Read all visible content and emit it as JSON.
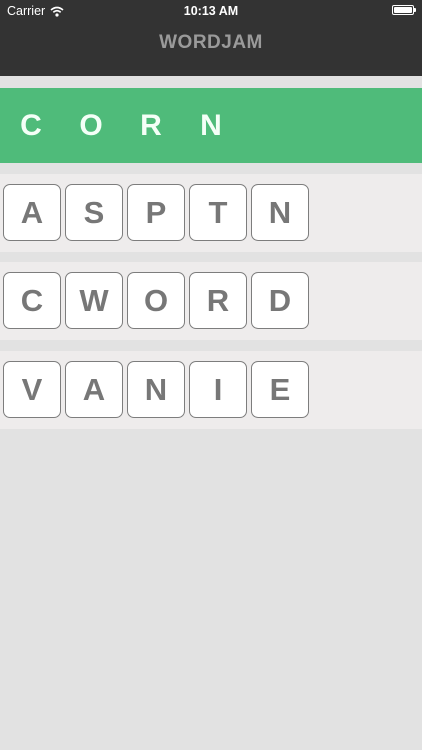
{
  "status_bar": {
    "carrier": "Carrier",
    "time": "10:13 AM"
  },
  "header": {
    "title": "WORDJAM"
  },
  "answer": {
    "letters": [
      "C",
      "O",
      "R",
      "N"
    ],
    "background_color": "#4fbb7a"
  },
  "rows": [
    {
      "letters": [
        "A",
        "S",
        "P",
        "T",
        "N"
      ]
    },
    {
      "letters": [
        "C",
        "W",
        "O",
        "R",
        "D"
      ]
    },
    {
      "letters": [
        "V",
        "A",
        "N",
        "I",
        "E"
      ]
    }
  ],
  "icons": {
    "wifi": "wifi-icon",
    "battery": "battery-icon"
  }
}
